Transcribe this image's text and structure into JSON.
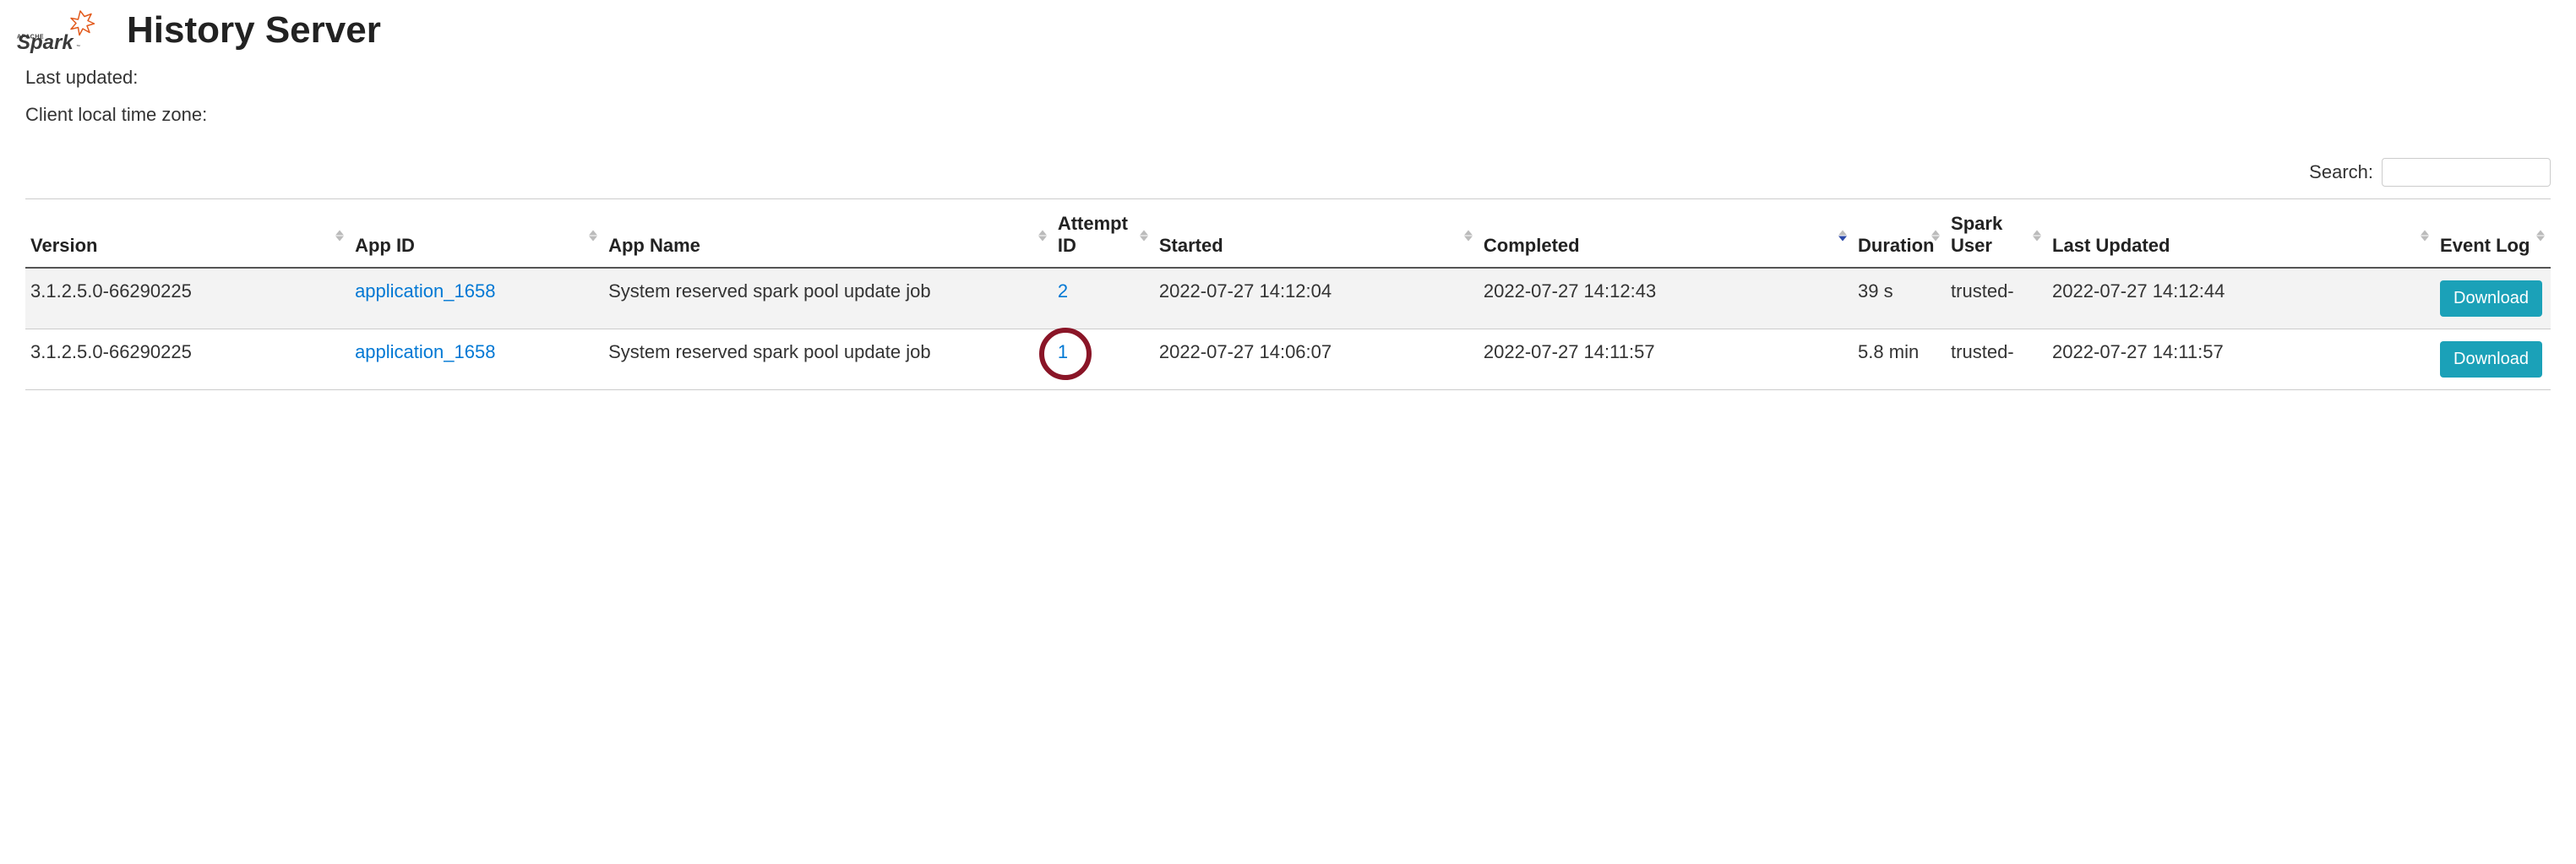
{
  "page_title": "History Server",
  "meta": {
    "last_updated_label": "Last updated:",
    "last_updated_value": "",
    "timezone_label": "Client local time zone:",
    "timezone_value": ""
  },
  "search": {
    "label": "Search:",
    "value": ""
  },
  "columns": {
    "version": "Version",
    "app_id": "App ID",
    "app_name": "App Name",
    "attempt_id": "Attempt ID",
    "started": "Started",
    "completed": "Completed",
    "duration": "Duration",
    "spark_user": "Spark User",
    "last_updated": "Last Updated",
    "event_log": "Event Log"
  },
  "rows": [
    {
      "version": "3.1.2.5.0-66290225",
      "app_id": "application_1658",
      "app_name": "System reserved spark pool update job",
      "attempt_id": "2",
      "started": "2022-07-27 14:12:04",
      "completed": "2022-07-27 14:12:43",
      "duration": "39 s",
      "spark_user": "trusted-",
      "last_updated": "2022-07-27 14:12:44",
      "event_log": "Download"
    },
    {
      "version": "3.1.2.5.0-66290225",
      "app_id": "application_1658",
      "app_name": "System reserved spark pool update job",
      "attempt_id": "1",
      "started": "2022-07-27 14:06:07",
      "completed": "2022-07-27 14:11:57",
      "duration": "5.8 min",
      "spark_user": "trusted-",
      "last_updated": "2022-07-27 14:11:57",
      "event_log": "Download"
    }
  ],
  "annotation": {
    "circled_attempt_id_row": 1
  }
}
